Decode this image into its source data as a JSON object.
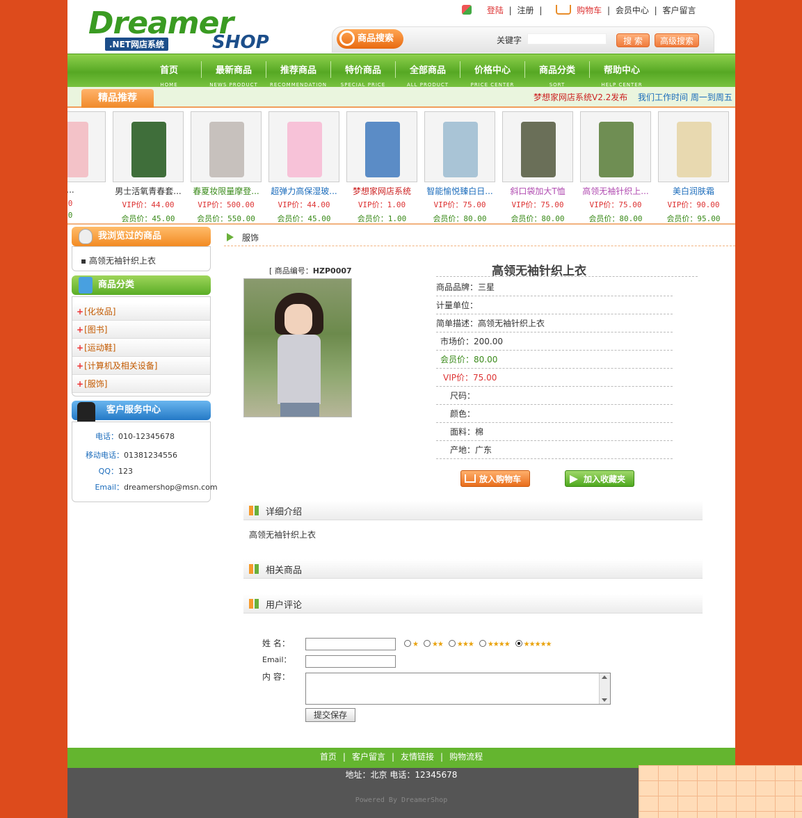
{
  "brand": {
    "logo_main": "Dreamer",
    "logo_net": ".NET网店系统",
    "logo_shop": "SHOP"
  },
  "toplinks": {
    "login": "登陆",
    "register": "注册",
    "cart": "购物车",
    "member": "会员中心",
    "message": "客户留言",
    "sep": "|"
  },
  "search": {
    "title": "商品搜索",
    "keyword_label": "关键字",
    "keyword_value": "",
    "search_btn": "搜 索",
    "advanced_btn": "高级搜索"
  },
  "nav": [
    {
      "zh": "首页",
      "en": "HOME"
    },
    {
      "zh": "最新商品",
      "en": "NEWS PRODUCT"
    },
    {
      "zh": "推荐商品",
      "en": "RECOMMENDATION"
    },
    {
      "zh": "特价商品",
      "en": "SPECIAL PRICE"
    },
    {
      "zh": "全部商品",
      "en": "ALL PRODUCT"
    },
    {
      "zh": "价格中心",
      "en": "PRICE CENTER"
    },
    {
      "zh": "商品分类",
      "en": "SORT"
    },
    {
      "zh": "帮助中心",
      "en": "HELP CENTER"
    }
  ],
  "featured": {
    "tab": "精品推荐",
    "news": "梦想家网店系统V2.2发布",
    "work": "我们工作时间  周一到周五"
  },
  "strip": [
    {
      "name": "...",
      "vip": "0",
      "mem": "0",
      "color": "#f3c2c8"
    },
    {
      "name": "男士活氧青春套...",
      "vip": "VIP价：44.00",
      "mem": "会员价：45.00",
      "color": "#3f6e3a"
    },
    {
      "name": "春夏妆限量摩登...",
      "vip": "VIP价：500.00",
      "mem": "会员价：550.00",
      "color": "#c7c1bd"
    },
    {
      "name": "超弹力高保湿玻...",
      "vip": "VIP价：44.00",
      "mem": "会员价：45.00",
      "color": "#f7c2d8"
    },
    {
      "name": "梦想家网店系统",
      "vip": "VIP价：1.00",
      "mem": "会员价：1.00",
      "color": "#5b8cc6"
    },
    {
      "name": "智能愉悦臻白日...",
      "vip": "VIP价：75.00",
      "mem": "会员价：80.00",
      "color": "#a9c4d6"
    },
    {
      "name": "斜口袋加大T恤",
      "vip": "VIP价：75.00",
      "mem": "会员价：80.00",
      "color": "#6a6f58"
    },
    {
      "name": "高领无袖针织上...",
      "vip": "VIP价：75.00",
      "mem": "会员价：80.00",
      "color": "#6f8e53"
    },
    {
      "name": "美白润肤霜",
      "vip": "VIP价：90.00",
      "mem": "会员价：95.00",
      "color": "#e8d9b0"
    }
  ],
  "strip_name_colors": [
    "#333",
    "#333",
    "#3a8a1a",
    "#1a6bbb",
    "#c22",
    "#1a6bbb",
    "#b04ab0",
    "#b04ab0",
    "#1a6bbb"
  ],
  "viewed": {
    "title": "我浏览过的商品",
    "item": "高领无袖针织上衣"
  },
  "categories": {
    "title": "商品分类",
    "items": [
      "[化妆品]",
      "[图书]",
      "[运动鞋]",
      "[计算机及相关设备]",
      "[服饰]"
    ]
  },
  "service": {
    "title": "客户服务中心",
    "phone_k": "电话：",
    "phone": "010-12345678",
    "mobile_k": "移动电话：",
    "mobile": "01381234556",
    "qq_k": "QQ：",
    "qq": "123",
    "email_k": "Email：",
    "email": "dreamershop@msn.com"
  },
  "breadcrumb": "服饰",
  "product": {
    "code_label": "[ 商品编号：",
    "code": "HZP0007",
    "title": "高领无袖针织上衣",
    "attrs": [
      {
        "k": "商品品牌：",
        "v": "三星"
      },
      {
        "k": "计量单位：",
        "v": ""
      },
      {
        "k": "简单描述：",
        "v": "高领无袖针织上衣"
      },
      {
        "k": "市场价：",
        "v": "200.00"
      },
      {
        "k": "会员价：",
        "v": "80.00"
      },
      {
        "k": "VIP价：",
        "v": "75.00"
      },
      {
        "k": "尺码：",
        "v": ""
      },
      {
        "k": "颜色：",
        "v": ""
      },
      {
        "k": "面料：",
        "v": "棉"
      },
      {
        "k": "产地：",
        "v": "广东"
      }
    ],
    "add_cart": "放入购物车",
    "add_fav": "加入收藏夹"
  },
  "sections": {
    "detail": "详细介绍",
    "detail_text": "高领无袖针织上衣",
    "related": "相关商品",
    "comments": "用户评论"
  },
  "form": {
    "name_label": "姓 名：",
    "email_label": "Email：",
    "content_label": "内 容：",
    "submit": "提交保存",
    "rating_selected": 5
  },
  "footer": {
    "links": [
      "首页",
      "客户留言",
      "友情链接",
      "购物流程"
    ],
    "sep": "|",
    "address": "地址：北京  电话：12345678",
    "powered": "Powered By DreamerShop"
  }
}
